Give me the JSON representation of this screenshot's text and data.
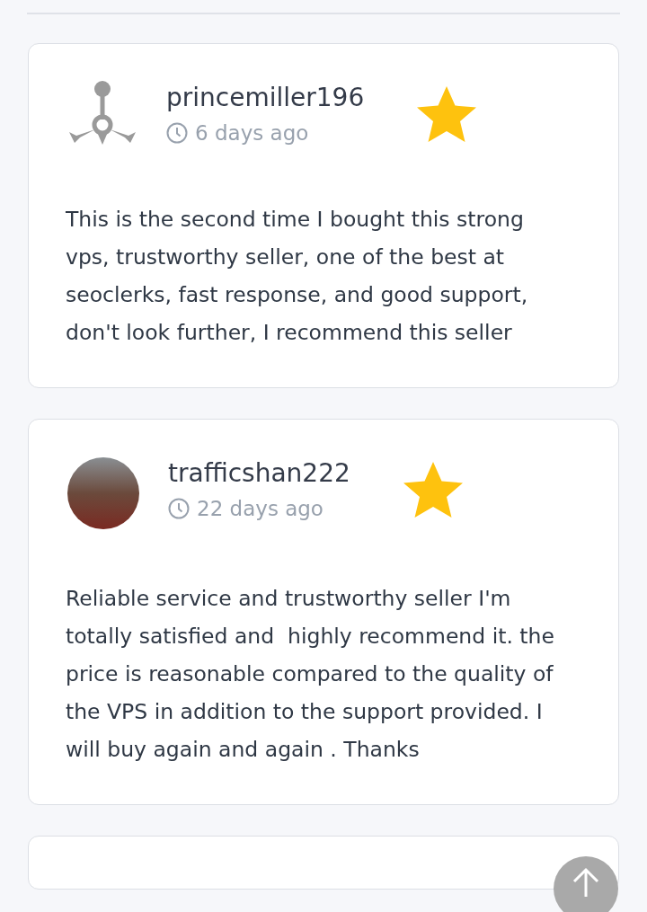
{
  "reviews": [
    {
      "username": "princemiller196",
      "time": "6 days ago",
      "kind": "default-avatar",
      "text": "This is the second time I bought this strong vps, trustworthy seller, one of the best at seoclerks, fast response, and good support, don't look further, I recommend this seller"
    },
    {
      "username": "trafficshan222",
      "time": "22 days ago",
      "kind": "photo-avatar",
      "text": "Reliable service and trustworthy seller I'm totally satisfied and  highly recommend it. the price is reasonable compared to the quality of the VPS in addition to the support provided. I will buy again and again . Thanks"
    }
  ]
}
